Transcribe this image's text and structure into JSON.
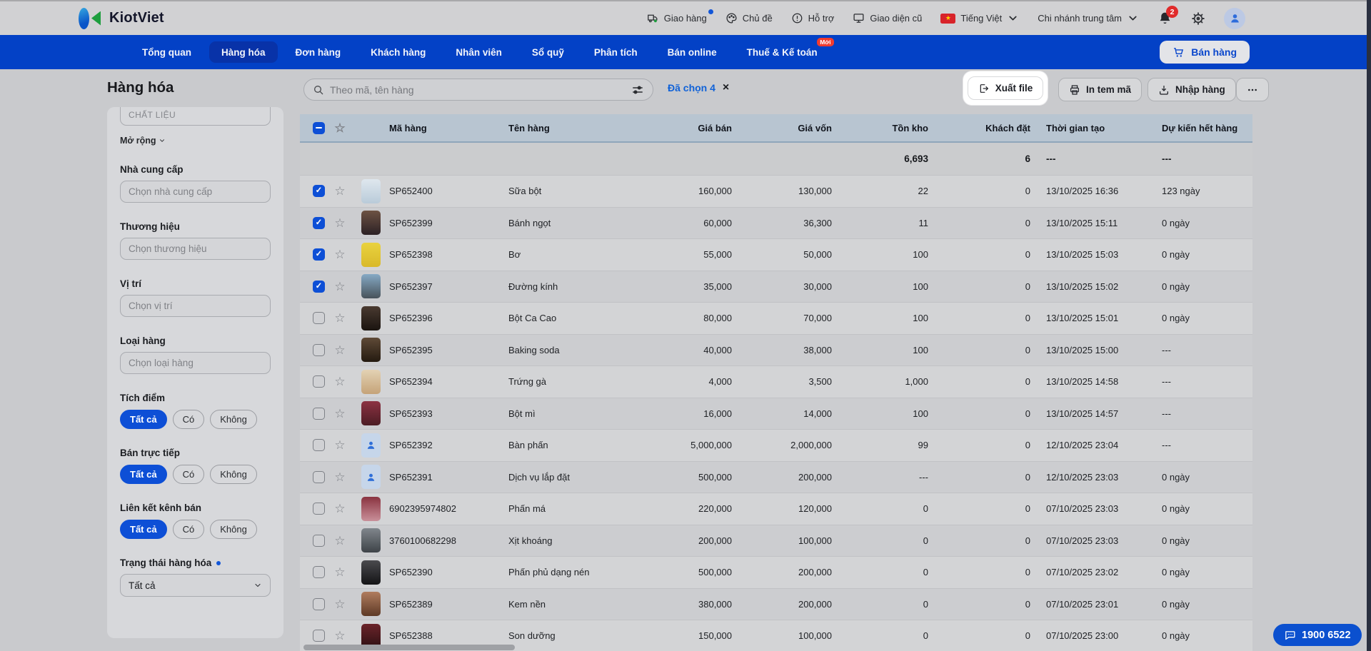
{
  "topbar": {
    "brand": "KiotViet",
    "quick_items": [
      {
        "label": "Giao hàng",
        "icon": "truck-icon",
        "dot": true
      },
      {
        "label": "Chủ đề",
        "icon": "palette-icon",
        "dot": false
      },
      {
        "label": "Hỗ trợ",
        "icon": "help-icon",
        "dot": false
      },
      {
        "label": "Giao diện cũ",
        "icon": "monitor-icon",
        "dot": false
      }
    ],
    "language": {
      "label": "Tiếng Việt",
      "flag_star": "★"
    },
    "branch": {
      "label": "Chi nhánh trung tâm"
    },
    "notification_count": "2"
  },
  "navbar": {
    "items": [
      {
        "label": "Tổng quan",
        "active": false
      },
      {
        "label": "Hàng hóa",
        "active": true
      },
      {
        "label": "Đơn hàng",
        "active": false
      },
      {
        "label": "Khách hàng",
        "active": false
      },
      {
        "label": "Nhân viên",
        "active": false
      },
      {
        "label": "Sổ quỹ",
        "active": false
      },
      {
        "label": "Phân tích",
        "active": false
      },
      {
        "label": "Bán online",
        "active": false
      },
      {
        "label": "Thuế & Kế toán",
        "active": false,
        "badge": "Mới"
      }
    ],
    "sell_button": "Bán hàng"
  },
  "page": {
    "title": "Hàng hóa"
  },
  "toolbar": {
    "search_placeholder": "Theo mã, tên hàng",
    "selected_chip": "Đã chọn 4",
    "chip_close": "×",
    "buttons": [
      {
        "label": "Xuất file",
        "icon": "export-icon",
        "highlighted": true
      },
      {
        "label": "In tem mã",
        "icon": "print-icon",
        "highlighted": false
      },
      {
        "label": "Nhập hàng",
        "icon": "import-icon",
        "highlighted": false
      },
      {
        "label": "",
        "icon": "more-icon",
        "highlighted": false
      }
    ]
  },
  "sidebar": {
    "clipped_input": "CHẤT LIỆU",
    "expand_label": "Mở rộng",
    "filters": [
      {
        "label": "Nhà cung cấp",
        "type": "input",
        "placeholder": "Chọn nhà cung cấp"
      },
      {
        "label": "Thương hiệu",
        "type": "input",
        "placeholder": "Chọn thương hiệu"
      },
      {
        "label": "Vị trí",
        "type": "input",
        "placeholder": "Chọn vị trí"
      },
      {
        "label": "Loại hàng",
        "type": "input",
        "placeholder": "Chọn loại hàng"
      },
      {
        "label": "Tích điểm",
        "type": "pills",
        "options": [
          "Tất cả",
          "Có",
          "Không"
        ],
        "selected": "Tất cả"
      },
      {
        "label": "Bán trực tiếp",
        "type": "pills",
        "options": [
          "Tất cả",
          "Có",
          "Không"
        ],
        "selected": "Tất cả"
      },
      {
        "label": "Liên kết kênh bán",
        "type": "pills",
        "options": [
          "Tất cả",
          "Có",
          "Không"
        ],
        "selected": "Tất cả"
      },
      {
        "label": "Trạng thái hàng hóa",
        "type": "select",
        "value": "Tất cả",
        "dot": true
      }
    ]
  },
  "table": {
    "columns": [
      "Mã hàng",
      "Tên hàng",
      "Giá bán",
      "Giá vốn",
      "Tồn kho",
      "Khách đặt",
      "Thời gian tạo",
      "Dự kiến hết hàng"
    ],
    "summary": {
      "stock": "6,693",
      "ordered": "6",
      "created": "---",
      "forecast": "---"
    },
    "rows": [
      {
        "checked": true,
        "code": "SP652400",
        "name": "Sữa bột",
        "price": "160,000",
        "cost": "130,000",
        "stock": "22",
        "ordered": "0",
        "created": "13/10/2025 16:36",
        "forecast": "123 ngày",
        "thumb": {
          "c1": "#dfe7ee",
          "c2": "#b9cbd9"
        }
      },
      {
        "checked": true,
        "code": "SP652399",
        "name": "Bánh ngọt",
        "price": "60,000",
        "cost": "36,300",
        "stock": "11",
        "ordered": "0",
        "created": "13/10/2025 15:11",
        "forecast": "0 ngày",
        "thumb": {
          "c1": "#6d5243",
          "c2": "#2c2125"
        }
      },
      {
        "checked": true,
        "code": "SP652398",
        "name": "Bơ",
        "price": "55,000",
        "cost": "50,000",
        "stock": "100",
        "ordered": "0",
        "created": "13/10/2025 15:03",
        "forecast": "0 ngày",
        "thumb": {
          "c1": "#e9d23e",
          "c2": "#d9b92a"
        }
      },
      {
        "checked": true,
        "code": "SP652397",
        "name": "Đường kính",
        "price": "35,000",
        "cost": "30,000",
        "stock": "100",
        "ordered": "0",
        "created": "13/10/2025 15:02",
        "forecast": "0 ngày",
        "thumb": {
          "c1": "#86a9c5",
          "c2": "#47525a"
        }
      },
      {
        "checked": false,
        "code": "SP652396",
        "name": "Bột Ca Cao",
        "price": "80,000",
        "cost": "70,000",
        "stock": "100",
        "ordered": "0",
        "created": "13/10/2025 15:01",
        "forecast": "0 ngày",
        "thumb": {
          "c1": "#4a3a30",
          "c2": "#1a1410"
        }
      },
      {
        "checked": false,
        "code": "SP652395",
        "name": "Baking soda",
        "price": "40,000",
        "cost": "38,000",
        "stock": "100",
        "ordered": "0",
        "created": "13/10/2025 15:00",
        "forecast": "---",
        "thumb": {
          "c1": "#5f4a37",
          "c2": "#241a10"
        }
      },
      {
        "checked": false,
        "code": "SP652394",
        "name": "Trứng gà",
        "price": "4,000",
        "cost": "3,500",
        "stock": "1,000",
        "ordered": "0",
        "created": "13/10/2025 14:58",
        "forecast": "---",
        "thumb": {
          "c1": "#e3d2b4",
          "c2": "#c5a378"
        }
      },
      {
        "checked": false,
        "code": "SP652393",
        "name": "Bột mì",
        "price": "16,000",
        "cost": "14,000",
        "stock": "100",
        "ordered": "0",
        "created": "13/10/2025 14:57",
        "forecast": "---",
        "thumb": {
          "c1": "#8c3242",
          "c2": "#4c1c24"
        }
      },
      {
        "checked": false,
        "code": "SP652392",
        "name": "Bàn phấn",
        "price": "5,000,000",
        "cost": "2,000,000",
        "stock": "99",
        "ordered": "0",
        "created": "12/10/2025 23:04",
        "forecast": "---",
        "thumb": {
          "placeholder": true
        }
      },
      {
        "checked": false,
        "code": "SP652391",
        "name": "Dịch vụ lắp đặt",
        "price": "500,000",
        "cost": "200,000",
        "stock": "---",
        "ordered": "0",
        "created": "12/10/2025 23:03",
        "forecast": "0 ngày",
        "thumb": {
          "placeholder": true
        }
      },
      {
        "checked": false,
        "code": "6902395974802",
        "name": "Phấn má",
        "price": "220,000",
        "cost": "120,000",
        "stock": "0",
        "ordered": "0",
        "created": "07/10/2025 23:03",
        "forecast": "0 ngày",
        "thumb": {
          "c1": "#8a3340",
          "c2": "#c9909a"
        }
      },
      {
        "checked": false,
        "code": "3760100682298",
        "name": "Xịt khoáng",
        "price": "200,000",
        "cost": "100,000",
        "stock": "0",
        "ordered": "0",
        "created": "07/10/2025 23:03",
        "forecast": "0 ngày",
        "thumb": {
          "c1": "#80868c",
          "c2": "#3e4348"
        }
      },
      {
        "checked": false,
        "code": "SP652390",
        "name": "Phấn phủ dạng nén",
        "price": "500,000",
        "cost": "200,000",
        "stock": "0",
        "ordered": "0",
        "created": "07/10/2025 23:02",
        "forecast": "0 ngày",
        "thumb": {
          "c1": "#4a4a4e",
          "c2": "#141416"
        }
      },
      {
        "checked": false,
        "code": "SP652389",
        "name": "Kem nền",
        "price": "380,000",
        "cost": "200,000",
        "stock": "0",
        "ordered": "0",
        "created": "07/10/2025 23:01",
        "forecast": "0 ngày",
        "thumb": {
          "c1": "#b07c5e",
          "c2": "#5e3a26"
        }
      },
      {
        "checked": false,
        "code": "SP652388",
        "name": "Son dưỡng",
        "price": "150,000",
        "cost": "100,000",
        "stock": "0",
        "ordered": "0",
        "created": "07/10/2025 23:00",
        "forecast": "0 ngày",
        "thumb": {
          "c1": "#6b242a",
          "c2": "#2e1013"
        }
      }
    ]
  },
  "footer": {
    "hotline": "1900 6522"
  },
  "colors": {
    "accent_blue": "#0d4fd6",
    "navbar_blue": "#0341c6",
    "nav_active_blue": "#0832a8",
    "table_header": "#b8c5d1",
    "badge_red": "#e02b2b",
    "link_blue": "#1062d8"
  }
}
